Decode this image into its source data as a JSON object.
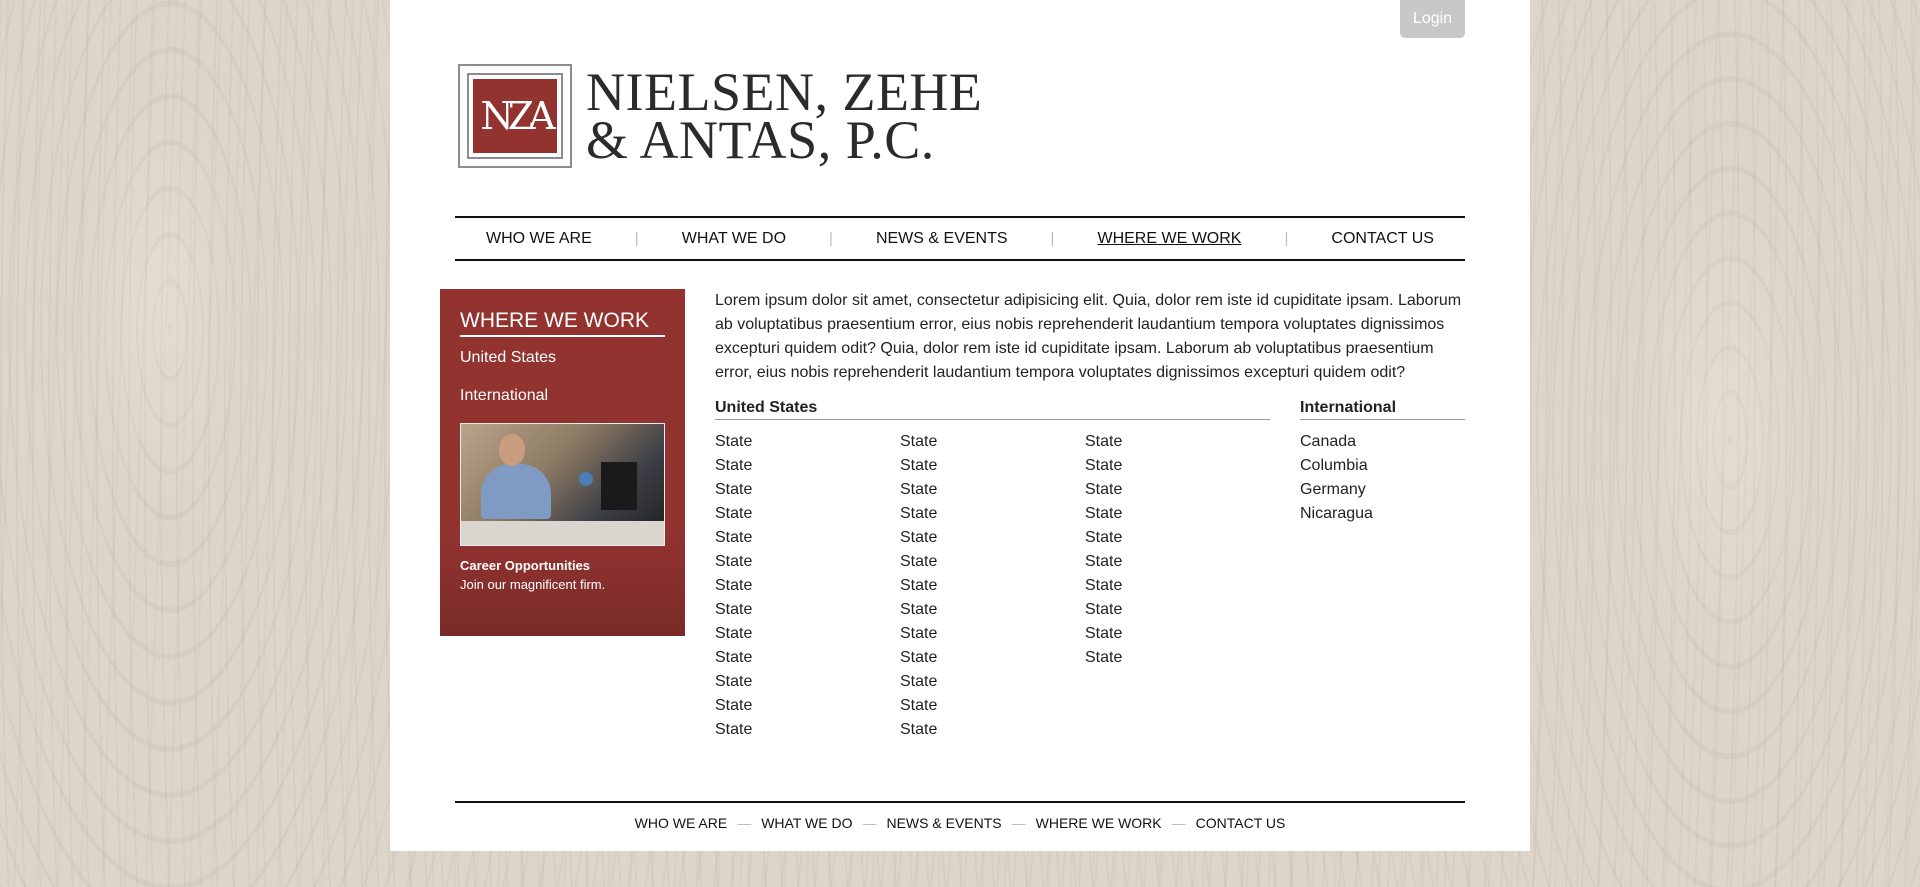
{
  "header": {
    "login_label": "Login",
    "logo": {
      "monogram": "NZA",
      "line1": "NIELSEN, ZEHE",
      "line2": "& ANTAS, P.C."
    }
  },
  "nav": {
    "items": [
      "WHO WE ARE",
      "WHAT WE DO",
      "NEWS & EVENTS",
      "WHERE WE WORK",
      "CONTACT US"
    ],
    "active": "WHERE WE WORK"
  },
  "sidebar": {
    "title": "WHERE WE WORK",
    "links": [
      "United States",
      "International"
    ],
    "career_title": "Career Opportunities",
    "career_sub": "Join our magnificent firm."
  },
  "main": {
    "intro": "Lorem ipsum dolor sit amet, consectetur adipisicing elit. Quia, dolor rem iste id cupiditate ipsam. Laborum ab voluptatibus praesentium error, eius nobis reprehenderit laudantium tempora voluptates dignissimos excepturi quidem odit? Quia, dolor rem iste id cupiditate ipsam. Laborum ab voluptatibus praesentium error, eius nobis reprehenderit laudantium tempora voluptates dignissimos excepturi quidem odit?",
    "us_heading": "United States",
    "us_columns": [
      [
        "State",
        "State",
        "State",
        "State",
        "State",
        "State",
        "State",
        "State",
        "State",
        "State",
        "State",
        "State",
        "State"
      ],
      [
        "State",
        "State",
        "State",
        "State",
        "State",
        "State",
        "State",
        "State",
        "State",
        "State",
        "State",
        "State",
        "State"
      ],
      [
        "State",
        "State",
        "State",
        "State",
        "State",
        "State",
        "State",
        "State",
        "State",
        "State"
      ]
    ],
    "intl_heading": "International",
    "intl_items": [
      "Canada",
      "Columbia",
      "Germany",
      "Nicaragua"
    ]
  },
  "footer": {
    "items": [
      "WHO WE ARE",
      "WHAT WE DO",
      "NEWS & EVENTS",
      "WHERE WE WORK",
      "CONTACT US"
    ]
  },
  "colors": {
    "brand_red": "#923330",
    "login_bg": "#c8c8c8"
  }
}
